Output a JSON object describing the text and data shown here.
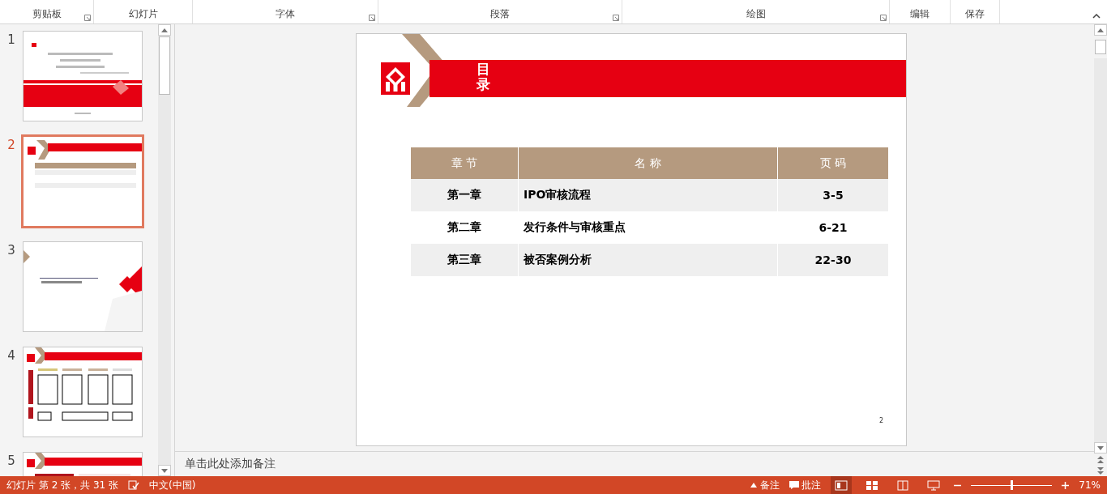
{
  "ribbon": {
    "groups": [
      {
        "label": "剪贴板",
        "launcher": true
      },
      {
        "label": "幻灯片",
        "launcher": false
      },
      {
        "label": "字体",
        "launcher": true
      },
      {
        "label": "段落",
        "launcher": true
      },
      {
        "label": "绘图",
        "launcher": true
      },
      {
        "label": "编辑",
        "launcher": false
      },
      {
        "label": "保存",
        "launcher": false
      }
    ]
  },
  "thumbnails": [
    {
      "number": "1",
      "kind": "cover",
      "selected": false
    },
    {
      "number": "2",
      "kind": "contents",
      "selected": true
    },
    {
      "number": "3",
      "kind": "chapter",
      "selected": false
    },
    {
      "number": "4",
      "kind": "boxes",
      "selected": false
    },
    {
      "number": "5",
      "kind": "header",
      "selected": false
    }
  ],
  "slide": {
    "title": "目录",
    "table": {
      "columns": [
        "章 节",
        "名 称",
        "页 码"
      ],
      "rows": [
        [
          "第一章",
          "IPO审核流程",
          "3-5"
        ],
        [
          "第二章",
          "发行条件与审核重点",
          "6-21"
        ],
        [
          "第三章",
          "被否案例分析",
          "22-30"
        ]
      ]
    },
    "page_number": "2"
  },
  "notes": {
    "placeholder": "单击此处添加备注"
  },
  "status_bar": {
    "slide_info": "幻灯片 第 2 张，共 31 张",
    "language": "中文(中国)",
    "notes": "备注",
    "comments": "批注",
    "views": [
      {
        "kind": "normal",
        "selected": true
      },
      {
        "kind": "sorter",
        "selected": false
      },
      {
        "kind": "reading",
        "selected": false
      },
      {
        "kind": "show",
        "selected": false
      }
    ],
    "zoom": {
      "level": 0.5,
      "reading": "71%"
    }
  }
}
